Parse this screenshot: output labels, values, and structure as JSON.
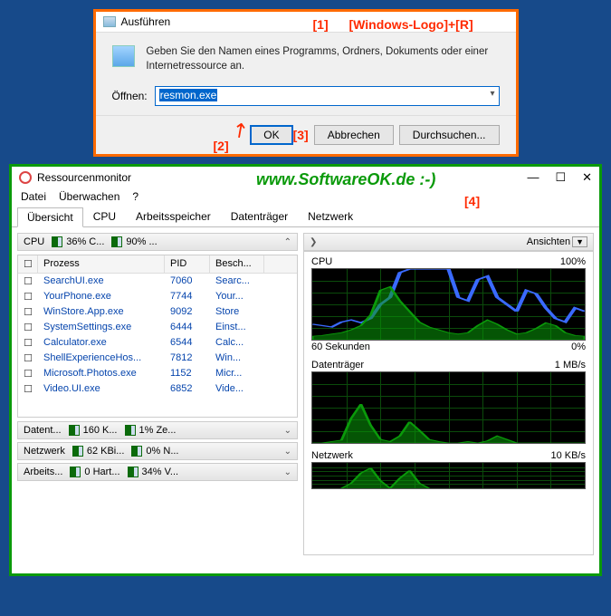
{
  "run": {
    "title": "Ausführen",
    "hint": "[Windows-Logo]+[R]",
    "desc": "Geben Sie den Namen eines Programms, Ordners, Dokuments oder einer Internetressource an.",
    "label": "Öffnen:",
    "value": "resmon.exe",
    "ok": "OK",
    "cancel": "Abbrechen",
    "browse": "Durchsuchen...",
    "anno1": "[1]",
    "anno2": "[2]",
    "anno3": "[3]"
  },
  "resmon": {
    "title": "Ressourcenmonitor",
    "softok": "www.SoftwareOK.de :-)",
    "anno4": "[4]",
    "menu": {
      "datei": "Datei",
      "ueberwachen": "Überwachen",
      "help": "?"
    },
    "tabs": {
      "uebersicht": "Übersicht",
      "cpu": "CPU",
      "arbeitsspeicher": "Arbeitsspeicher",
      "datentraeger": "Datenträger",
      "netzwerk": "Netzwerk"
    },
    "cpu_header": {
      "label": "CPU",
      "pct1": "36% C...",
      "pct2": "90% ..."
    },
    "table": {
      "cols": {
        "prozess": "Prozess",
        "pid": "PID",
        "besch": "Besch..."
      },
      "rows": [
        {
          "name": "SearchUI.exe",
          "pid": "7060",
          "desc": "Searc..."
        },
        {
          "name": "YourPhone.exe",
          "pid": "7744",
          "desc": "Your..."
        },
        {
          "name": "WinStore.App.exe",
          "pid": "9092",
          "desc": "Store"
        },
        {
          "name": "SystemSettings.exe",
          "pid": "6444",
          "desc": "Einst..."
        },
        {
          "name": "Calculator.exe",
          "pid": "6544",
          "desc": "Calc..."
        },
        {
          "name": "ShellExperienceHos...",
          "pid": "7812",
          "desc": "Win..."
        },
        {
          "name": "Microsoft.Photos.exe",
          "pid": "1152",
          "desc": "Micr..."
        },
        {
          "name": "Video.UI.exe",
          "pid": "6852",
          "desc": "Vide..."
        }
      ]
    },
    "mini": {
      "datent": {
        "label": "Datent...",
        "v1": "160 K...",
        "v2": "1% Ze..."
      },
      "netzwerk": {
        "label": "Netzwerk",
        "v1": "62 KBi...",
        "v2": "0% N..."
      },
      "arbeits": {
        "label": "Arbeits...",
        "v1": "0 Hart...",
        "v2": "34% V..."
      }
    },
    "ansichten": "Ansichten",
    "charts": {
      "cpu": {
        "label": "CPU",
        "max": "100%",
        "sub": "60 Sekunden",
        "sub2": "0%"
      },
      "datentraeger": {
        "label": "Datenträger",
        "max": "1 MB/s"
      },
      "netzwerk": {
        "label": "Netzwerk",
        "max": "10 KB/s"
      }
    }
  },
  "chart_data": {
    "cpu": {
      "type": "line",
      "x_range": [
        0,
        60
      ],
      "ylim": [
        0,
        100
      ],
      "series": [
        {
          "name": "max_freq",
          "color": "#3a6aff",
          "values": [
            22,
            20,
            18,
            25,
            28,
            24,
            30,
            50,
            60,
            95,
            100,
            100,
            100,
            100,
            100,
            60,
            55,
            85,
            90,
            60,
            50,
            40,
            70,
            65,
            45,
            30,
            25,
            45,
            40
          ]
        },
        {
          "name": "usage",
          "color": "#0a9a0a",
          "fill": true,
          "values": [
            5,
            6,
            8,
            10,
            14,
            20,
            35,
            70,
            75,
            55,
            40,
            25,
            18,
            14,
            10,
            8,
            10,
            20,
            28,
            22,
            14,
            8,
            10,
            16,
            24,
            20,
            10,
            6,
            5
          ]
        }
      ]
    },
    "datentraeger": {
      "type": "area",
      "ylim": [
        0,
        1
      ],
      "series": [
        {
          "name": "io",
          "color": "#0a9a0a",
          "fill": true,
          "values": [
            0,
            0,
            0.02,
            0.04,
            0.35,
            0.55,
            0.25,
            0.05,
            0.02,
            0.1,
            0.3,
            0.18,
            0.05,
            0.02,
            0,
            0,
            0.02,
            0,
            0.03,
            0.1,
            0.05,
            0,
            0,
            0,
            0,
            0,
            0,
            0,
            0
          ]
        }
      ]
    },
    "netzwerk": {
      "type": "area",
      "ylim": [
        0,
        10
      ],
      "series": [
        {
          "name": "kbps",
          "color": "#0a9a0a",
          "fill": true,
          "values": [
            0,
            0,
            0,
            0,
            2,
            6,
            8,
            3,
            0,
            4,
            7,
            2,
            0,
            0,
            0,
            0,
            0,
            0,
            0,
            0,
            0,
            0,
            0,
            0,
            0,
            0,
            0,
            0,
            0
          ]
        }
      ]
    }
  }
}
